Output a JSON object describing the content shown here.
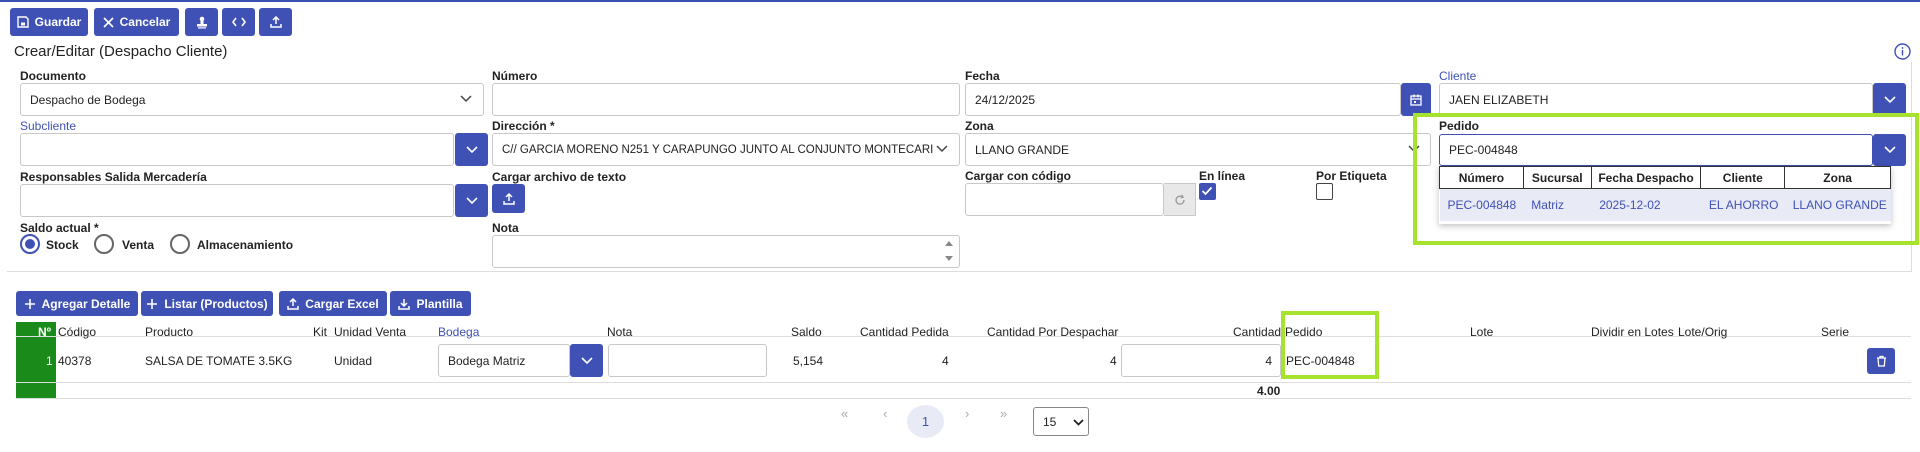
{
  "toolbar": {
    "save": "Guardar",
    "cancel": "Cancelar"
  },
  "page_title": "Crear/Editar (Despacho Cliente)",
  "form": {
    "documento": {
      "label": "Documento",
      "value": "Despacho de Bodega"
    },
    "numero": {
      "label": "Número",
      "value": ""
    },
    "fecha": {
      "label": "Fecha",
      "value": "24/12/2025"
    },
    "cliente": {
      "label": "Cliente",
      "value": "JAEN ELIZABETH"
    },
    "subcliente": {
      "label": "Subcliente",
      "value": ""
    },
    "direccion": {
      "label": "Dirección",
      "required": "*",
      "value": "C// GARCIA MORENO N251 Y CARAPUNGO JUNTO AL CONJUNTO MONTECARI"
    },
    "zona": {
      "label": "Zona",
      "value": "LLANO GRANDE"
    },
    "pedido": {
      "label": "Pedido",
      "value": "PEC-004848"
    },
    "responsables": {
      "label": "Responsables Salida Mercadería",
      "value": ""
    },
    "cargar_archivo": {
      "label": "Cargar archivo de texto"
    },
    "cargar_codigo": {
      "label": "Cargar con código",
      "value": ""
    },
    "en_linea": {
      "label": "En línea",
      "checked": true
    },
    "por_etiqueta": {
      "label": "Por Etiqueta",
      "checked": false
    },
    "saldo_actual": {
      "label": "Saldo actual",
      "required": "*",
      "options": [
        "Stock",
        "Venta",
        "Almacenamiento"
      ],
      "selected": "Stock"
    },
    "nota": {
      "label": "Nota",
      "value": ""
    }
  },
  "pedido_dropdown": {
    "headers": [
      "Número",
      "Sucursal",
      "Fecha Despacho",
      "Cliente",
      "Zona"
    ],
    "rows": [
      [
        "PEC-004848",
        "Matriz",
        "2025-12-02",
        "EL AHORRO",
        "LLANO GRANDE"
      ]
    ]
  },
  "actions": {
    "agregar": "Agregar Detalle",
    "listar": "Listar (Productos)",
    "excel": "Cargar Excel",
    "plantilla": "Plantilla"
  },
  "table": {
    "headers": {
      "no": "Nº",
      "codigo": "Código",
      "producto": "Producto",
      "kit": "Kit",
      "unidad": "Unidad Venta",
      "bodega": "Bodega",
      "nota": "Nota",
      "saldo": "Saldo",
      "cant_pedida": "Cantidad Pedida",
      "cant_por_desp": "Cantidad Por Despachar",
      "cantidad": "Cantidad",
      "pedido": "Pedido",
      "lote": "Lote",
      "dividir": "Dividir en Lotes",
      "lote_orig": "Lote/Orig",
      "serie": "Serie"
    },
    "row": {
      "no": "1",
      "codigo": "40378",
      "producto": "SALSA DE TOMATE 3.5KG",
      "unidad": "Unidad",
      "bodega": "Bodega Matriz",
      "nota": "",
      "saldo": "5,154",
      "cant_pedida": "4",
      "cant_por_desp": "4",
      "cantidad": "4",
      "pedido": "PEC-004848"
    },
    "total_cantidad": "4.00"
  },
  "pagination": {
    "current": "1",
    "first": "«",
    "prev": "‹",
    "next": "›",
    "last": "»",
    "page_size": "15"
  },
  "colors": {
    "primary": "#3f51b5",
    "highlight": "#a6e22e",
    "row_green": "#1a8a1a"
  }
}
